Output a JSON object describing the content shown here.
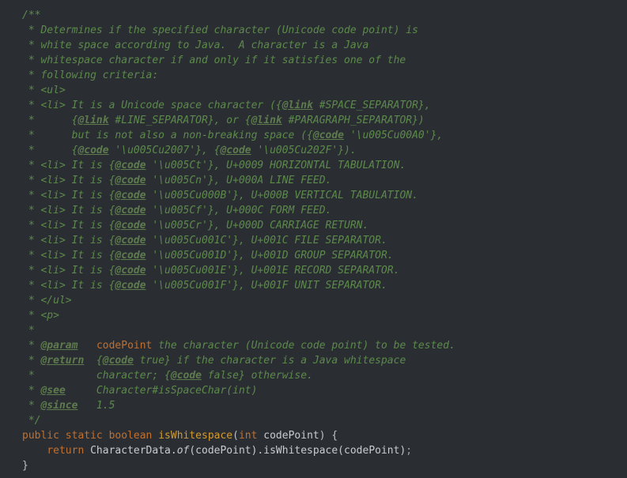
{
  "code": {
    "jdoc_open": "/**",
    "l1": " * Determines if the specified character (Unicode code point) is",
    "l2": " * white space according to Java.  A character is a Java",
    "l3": " * whitespace character if and only if it satisfies one of the",
    "l4": " * following criteria:",
    "l5": " * <ul>",
    "l6a": " * <li> It is a Unicode space character ({",
    "l6b": "@link",
    "l6c": " #SPACE_SEPARATOR},",
    "l7a": " *      {",
    "l7b": "@link",
    "l7c": " #LINE_SEPARATOR}, or {",
    "l7d": "@link",
    "l7e": " #PARAGRAPH_SEPARATOR})",
    "l8a": " *      but is not also a non-breaking space ({",
    "l8b": "@code",
    "l8c": " '\\u005Cu00A0'},",
    "l9a": " *      {",
    "l9b": "@code",
    "l9c": " '\\u005Cu2007'}, {",
    "l9d": "@code",
    "l9e": " '\\u005Cu202F'}).",
    "l10a": " * <li> It is {",
    "l10b": "@code",
    "l10c": " '\\u005Ct'}, U+0009 HORIZONTAL TABULATION.",
    "l11a": " * <li> It is {",
    "l11b": "@code",
    "l11c": " '\\u005Cn'}, U+000A LINE FEED.",
    "l12a": " * <li> It is {",
    "l12b": "@code",
    "l12c": " '\\u005Cu000B'}, U+000B VERTICAL TABULATION.",
    "l13a": " * <li> It is {",
    "l13b": "@code",
    "l13c": " '\\u005Cf'}, U+000C FORM FEED.",
    "l14a": " * <li> It is {",
    "l14b": "@code",
    "l14c": " '\\u005Cr'}, U+000D CARRIAGE RETURN.",
    "l15a": " * <li> It is {",
    "l15b": "@code",
    "l15c": " '\\u005Cu001C'}, U+001C FILE SEPARATOR.",
    "l16a": " * <li> It is {",
    "l16b": "@code",
    "l16c": " '\\u005Cu001D'}, U+001D GROUP SEPARATOR.",
    "l17a": " * <li> It is {",
    "l17b": "@code",
    "l17c": " '\\u005Cu001E'}, U+001E RECORD SEPARATOR.",
    "l18a": " * <li> It is {",
    "l18b": "@code",
    "l18c": " '\\u005Cu001F'}, U+001F UNIT SEPARATOR.",
    "l19": " * </ul>",
    "l20": " * <p>",
    "l21": " *",
    "l22a": " * ",
    "l22tag": "@param",
    "l22b": "   ",
    "l22p": "codePoint",
    "l22c": " the character (Unicode code point) to be tested.",
    "l23a": " * ",
    "l23tag": "@return",
    "l23b": "  {",
    "l23c": "@code",
    "l23d": " true} if the character is a Java whitespace",
    "l24a": " *          character; {",
    "l24b": "@code",
    "l24c": " false} otherwise.",
    "l25a": " * ",
    "l25tag": "@see",
    "l25b": "     Character#isSpaceChar(int)",
    "l26a": " * ",
    "l26tag": "@since",
    "l26b": "   1.5",
    "l27": " */",
    "sig_public": "public",
    "sig_static": "static",
    "sig_boolean": "boolean",
    "sig_method": "isWhitespace",
    "sig_lpar": "(",
    "sig_ptype": "int",
    "sig_pname": " codePoint",
    "sig_rpar": ")",
    "sig_lbrace": " {",
    "body_indent": "    ",
    "body_return": "return",
    "body_expr": " CharacterData.",
    "body_of": "of",
    "body_rest": "(codePoint).isWhitespace(codePoint)",
    "body_semi": ";",
    "rbrace": "}"
  }
}
